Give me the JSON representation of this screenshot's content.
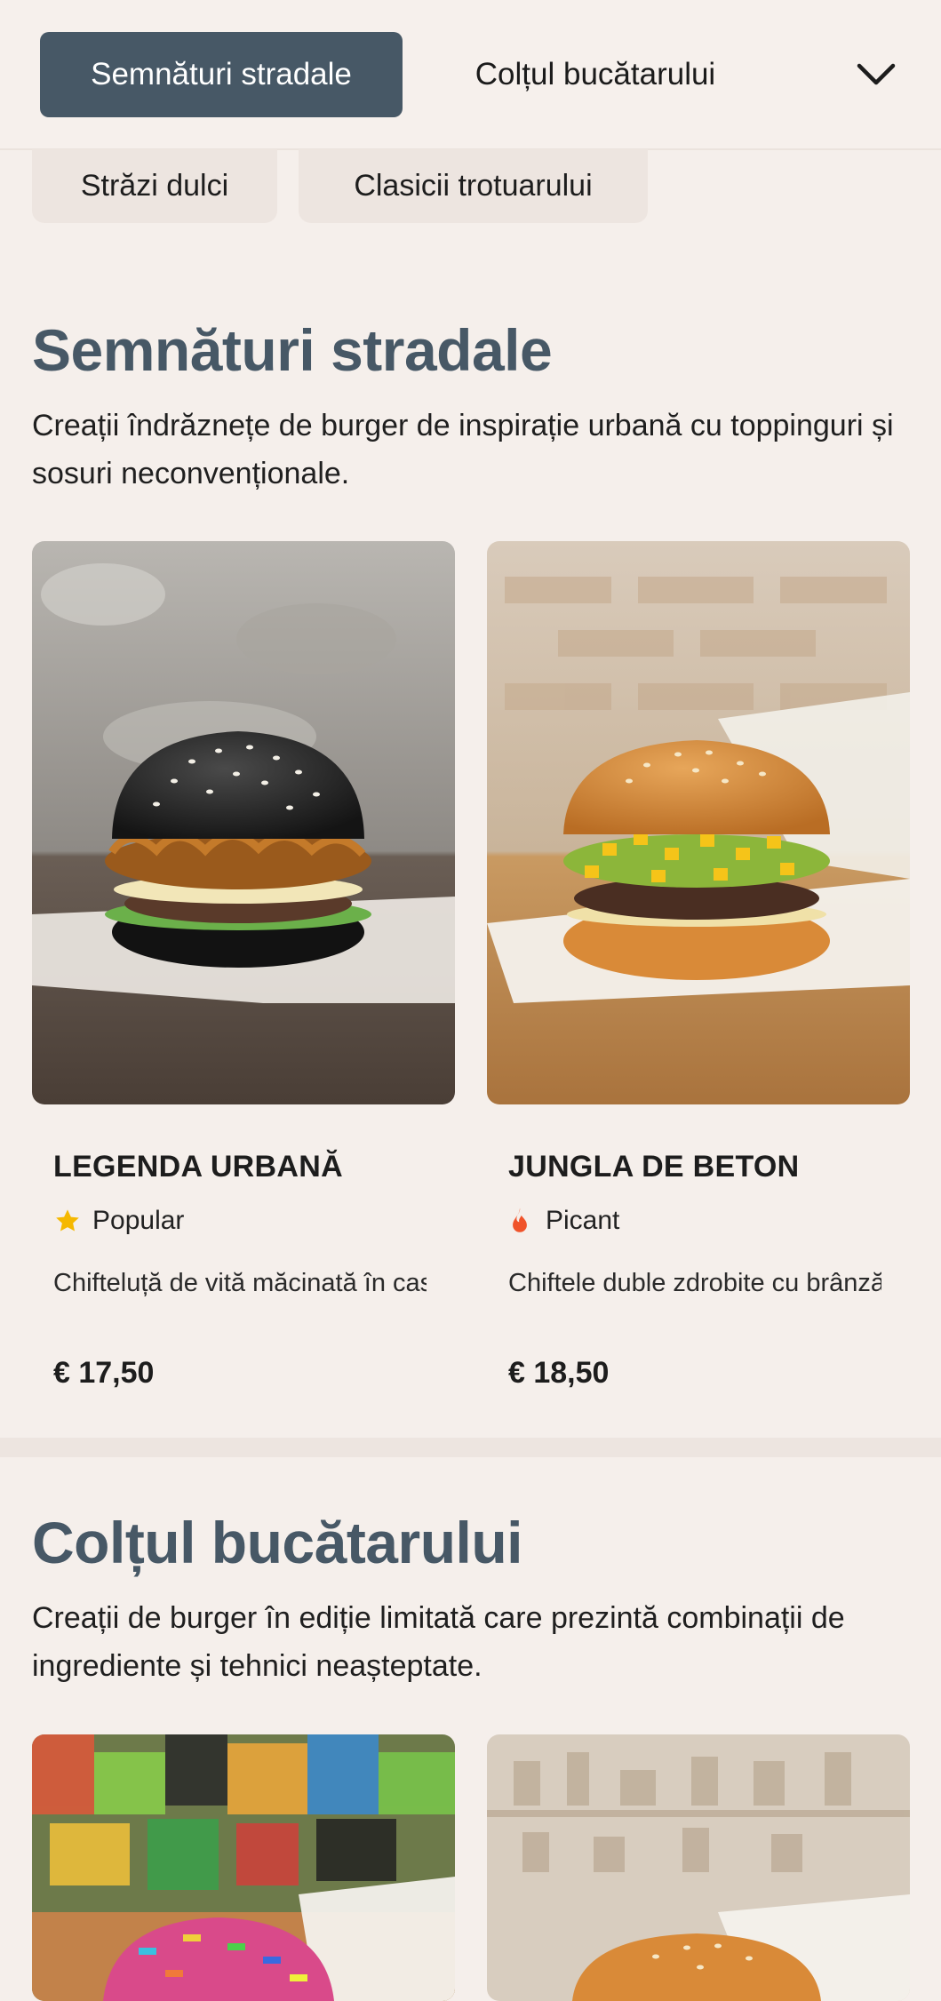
{
  "nav": {
    "tabs": [
      {
        "label": "Semnături stradale",
        "active": true
      },
      {
        "label": "Colțul bucătarului",
        "active": false
      }
    ],
    "more_icon": "chevron-down-icon",
    "sub_tabs": [
      {
        "label": "Străzi dulci"
      },
      {
        "label": "Clasicii trotuarului"
      }
    ]
  },
  "sections": [
    {
      "title": "Semnături stradale",
      "description": "Creații îndrăznețe de burger de inspirație urbană cu toppinguri și sosuri neconvenționale.",
      "items": [
        {
          "name": "LEGENDA URBANĂ",
          "badge": {
            "icon": "star-icon",
            "label": "Popular",
            "color": "#f5b800"
          },
          "description": "Chifteluță de vită măcinată în casă cu brânză albastră, ge...",
          "price": "€ 17,50"
        },
        {
          "name": "JUNGLA DE BETON",
          "badge": {
            "icon": "flame-icon",
            "label": "Picant",
            "color": "#f0532a"
          },
          "description": "Chiftele duble zdrobite cu brânză americană, sos de...",
          "price": "€ 18,50"
        }
      ]
    },
    {
      "title": "Colțul bucătarului",
      "description": "Creații de burger în ediție limitată care prezintă combinații de ingrediente și tehnici neașteptate."
    }
  ],
  "colors": {
    "accent": "#475866",
    "background": "#f5efeb",
    "pill_background": "#ede5e0"
  }
}
